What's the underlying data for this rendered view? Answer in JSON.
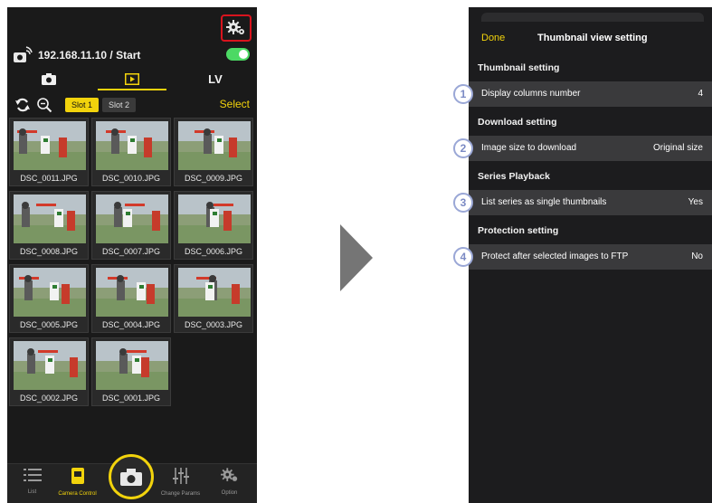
{
  "left_screen": {
    "connection": {
      "address_text": "192.168.11.10 / Start",
      "toggle_on": true
    },
    "mode_tabs": [
      {
        "label": "",
        "icon": "camera-icon"
      },
      {
        "label": "",
        "icon": "playback-icon",
        "active": true
      },
      {
        "label": "LV"
      }
    ],
    "toolbar": {
      "slot1": "Slot 1",
      "slot2": "Slot 2",
      "select": "Select",
      "active_slot": "Slot 1"
    },
    "thumbnails": [
      "DSC_0011.JPG",
      "DSC_0010.JPG",
      "DSC_0009.JPG",
      "DSC_0008.JPG",
      "DSC_0007.JPG",
      "DSC_0006.JPG",
      "DSC_0005.JPG",
      "DSC_0004.JPG",
      "DSC_0003.JPG",
      "DSC_0002.JPG",
      "DSC_0001.JPG"
    ],
    "tabbar": [
      {
        "label": "List",
        "icon": "list-icon"
      },
      {
        "label": "Camera Control",
        "icon": "camera-control-icon",
        "active": true
      },
      {
        "label": "Change Params",
        "icon": "sliders-icon"
      },
      {
        "label": "Option",
        "icon": "gear-icon"
      }
    ],
    "colors": {
      "accent": "#f2d30c",
      "highlight_box": "#d9141e",
      "toggle": "#4cd964"
    }
  },
  "right_screen": {
    "nav": {
      "done": "Done",
      "title": "Thumbnail view setting"
    },
    "sections": [
      {
        "header": "Thumbnail setting",
        "badge": "1",
        "label": "Display columns number",
        "value": "4"
      },
      {
        "header": "Download setting",
        "badge": "2",
        "label": "Image size to download",
        "value": "Original size"
      },
      {
        "header": "Series Playback",
        "badge": "3",
        "label": "List series as single thumbnails",
        "value": "Yes"
      },
      {
        "header": "Protection setting",
        "badge": "4",
        "label": "Protect after selected images to FTP",
        "value": "No"
      }
    ]
  }
}
